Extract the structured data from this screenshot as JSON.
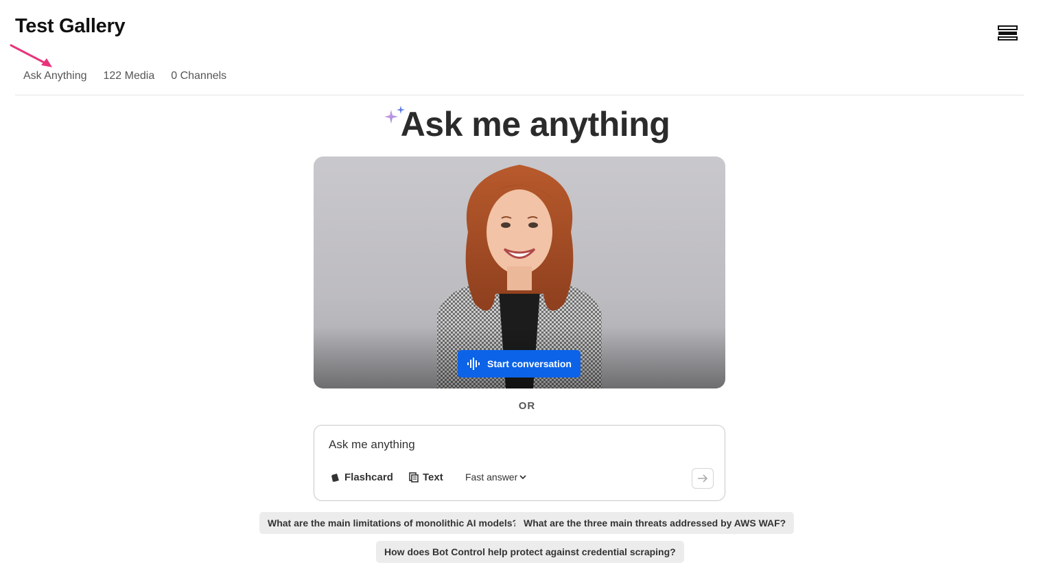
{
  "header": {
    "title": "Test Gallery",
    "menu_icon": "menu-icon"
  },
  "tabs": [
    {
      "label": "Ask Anything",
      "active": true
    },
    {
      "label": "122 Media",
      "active": false
    },
    {
      "label": "0 Channels",
      "active": false
    }
  ],
  "hero": {
    "title": "Ask me anything",
    "icon": "sparkle-icon"
  },
  "video": {
    "start_label": "Start conversation",
    "icon": "waveform-icon",
    "accent": "#0c63e7"
  },
  "divider": {
    "or_label": "OR"
  },
  "ask": {
    "placeholder": "Ask me anything",
    "flashcard_label": "Flashcard",
    "text_label": "Text",
    "mode_selected": "Fast answer",
    "send_icon": "arrow-right-icon"
  },
  "suggestions": [
    "What are the main limitations of monolithic AI models?",
    "What are the three main threats addressed by AWS WAF?",
    "How does Bot Control help protect against credential scraping?"
  ],
  "colors": {
    "annotation_arrow": "#e8337a",
    "primary": "#0c63e7"
  }
}
